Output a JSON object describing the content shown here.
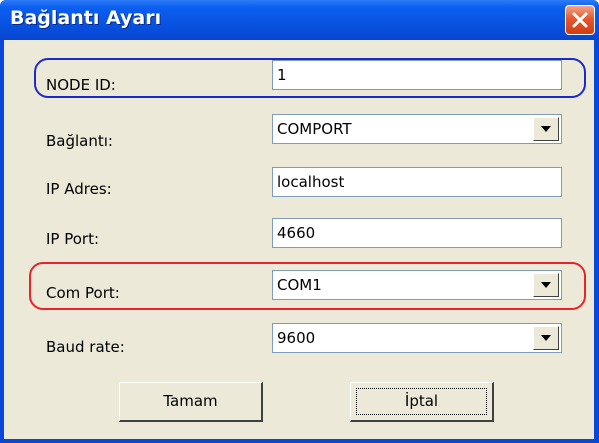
{
  "window": {
    "title": "Bağlantı Ayarı",
    "close_icon": "close-icon"
  },
  "form": {
    "node_id": {
      "label": "NODE ID:",
      "value": "1"
    },
    "baglanti": {
      "label": "Bağlantı:",
      "value": "COMPORT"
    },
    "ip_adres": {
      "label": "IP Adres:",
      "value": "localhost"
    },
    "ip_port": {
      "label": "IP Port:",
      "value": "4660"
    },
    "com_port": {
      "label": "Com Port:",
      "value": "COM1"
    },
    "baud_rate": {
      "label": "Baud rate:",
      "value": "9600"
    }
  },
  "buttons": {
    "ok_label": "Tamam",
    "cancel_label": "İptal"
  },
  "annotations": {
    "node_id_color": "#1c2bc8",
    "com_port_color": "#e8242a"
  },
  "colors": {
    "titlebar": "#0954e4",
    "dialog_background": "#ece9d8",
    "close_button": "#e5582f"
  }
}
